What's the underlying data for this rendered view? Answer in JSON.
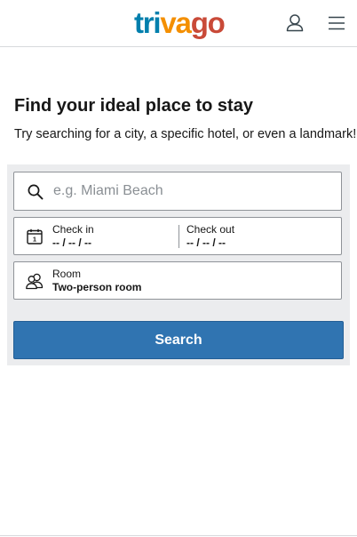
{
  "header": {
    "logo_parts": [
      "tri",
      "va",
      "go"
    ],
    "user_icon": "user-icon",
    "menu_icon": "hamburger-menu-icon"
  },
  "hero": {
    "title": "Find your ideal place to stay",
    "subtitle": "Try searching for a city, a specific hotel, or even a landmark!"
  },
  "search": {
    "destination_placeholder": "e.g. Miami Beach",
    "destination_value": "",
    "destination_icon": "search-icon",
    "check_in": {
      "label": "Check in",
      "value": "-- / -- / --",
      "icon": "calendar-icon",
      "icon_day": "1"
    },
    "check_out": {
      "label": "Check out",
      "value": "-- / -- / --"
    },
    "room": {
      "label": "Room",
      "value": "Two-person room",
      "icon": "people-icon"
    },
    "button_label": "Search"
  },
  "colors": {
    "logo_blue": "#007fad",
    "logo_orange": "#f48f00",
    "logo_red": "#c94a38",
    "primary_button": "#3074b1",
    "panel_background": "#ebecee"
  }
}
